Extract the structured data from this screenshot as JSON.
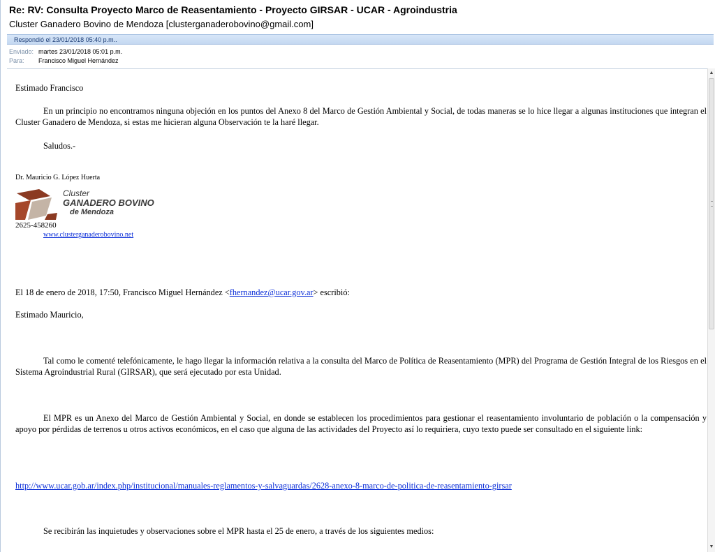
{
  "header": {
    "subject": "Re: RV: Consulta Proyecto Marco de Reasentamiento - Proyecto GIRSAR - UCAR - Agroindustria",
    "sender": "Cluster Ganadero Bovino de Mendoza [clusterganaderobovino@gmail.com]",
    "info_bar": "Respondió el 23/01/2018 05:40 p.m..",
    "sent_label": "Enviado:",
    "sent_value": "martes 23/01/2018 05:01 p.m.",
    "to_label": "Para:",
    "to_value": "Francisco Miguel Hernández"
  },
  "body": {
    "greeting": "Estimado Francisco",
    "para1": "En un principio no encontramos ninguna objeción en los puntos del Anexo 8 del Marco de Gestión Ambiental y Social, de todas maneras se lo hice llegar a algunas instituciones que integran el Cluster Ganadero de Mendoza, si estas me hicieran alguna Observación te la haré llegar.",
    "closing": "Saludos.-",
    "signature_name": "Dr. Mauricio G. López Huerta",
    "logo_line1": "Cluster",
    "logo_line2": "GANADERO BOVINO",
    "logo_line3": "de Mendoza",
    "phone": "2625-458260",
    "website": "www.clusterganaderobovino.net",
    "quote_intro_prefix": "El 18 de enero de 2018, 17:50, Francisco Miguel Hernández <",
    "quote_intro_email": "fhernandez@ucar.gov.ar",
    "quote_intro_suffix": "> escribió:",
    "quote_greeting": "Estimado Mauricio,",
    "quote_para1": "Tal como le comenté telefónicamente, le hago llegar la información relativa a la consulta del Marco de Política de Reasentamiento (MPR) del Programa de Gestión Integral de los Riesgos en el Sistema Agroindustrial Rural (GIRSAR), que será ejecutado por esta Unidad.",
    "quote_para2": "El MPR es un Anexo del Marco de Gestión Ambiental y Social, en donde se establecen los procedimientos para gestionar el reasentamiento involuntario de población o la compensación y apoyo por pérdidas de terrenos u otros activos económicos, en el caso que alguna de las actividades del Proyecto así lo requiriera, cuyo texto puede ser consultado en el siguiente link:",
    "quote_link": "http://www.ucar.gob.ar/index.php/institucional/manuales-reglamentos-y-salvaguardas/2628-anexo-8-marco-de-politica-de-reasentamiento-girsar",
    "quote_para3": "Se recibirán las inquietudes y observaciones sobre el MPR hasta el 25 de enero, a través de los siguientes medios:"
  },
  "icons": {
    "scroll_up": "scroll-up-arrow-icon",
    "scroll_down": "scroll-down-arrow-icon"
  },
  "colors": {
    "link": "#0b2ed8",
    "info_bar": "#c4d8f1",
    "logo_brown": "#8b3a22"
  }
}
